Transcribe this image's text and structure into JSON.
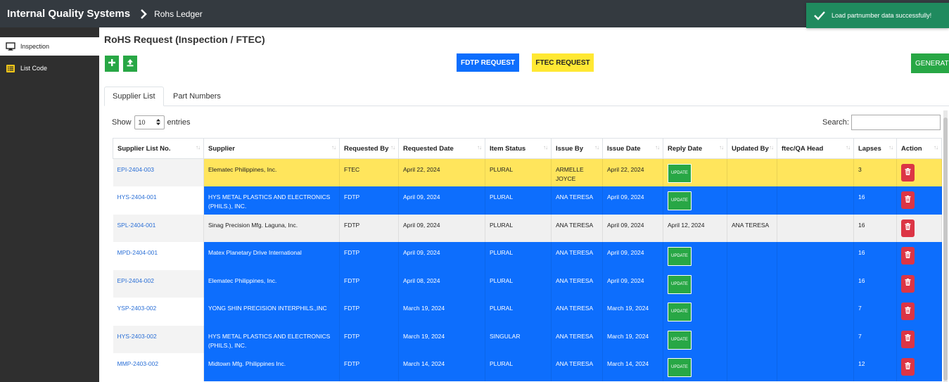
{
  "header": {
    "brand": "Internal Quality Systems",
    "breadcrumb": "Rohs Ledger"
  },
  "toast": {
    "message": "Load partnumber data successfully!"
  },
  "sidebar": {
    "items": [
      {
        "label": "Inspection",
        "icon": "monitor-icon",
        "active": true
      },
      {
        "label": "List Code",
        "icon": "list-icon",
        "active": false
      }
    ]
  },
  "main": {
    "title": "RoHS Request (Inspection / FTEC)",
    "buttons": {
      "add": "+",
      "fdtp": "FDTP REQUEST",
      "ftec": "FTEC REQUEST",
      "generate": "GENERAT"
    },
    "tabs": [
      {
        "label": "Supplier List",
        "active": true
      },
      {
        "label": "Part Numbers",
        "active": false
      }
    ],
    "show": {
      "prefix": "Show",
      "value": "10",
      "suffix": "entries"
    },
    "search": {
      "label": "Search:"
    }
  },
  "table": {
    "columns": [
      "Supplier List No.",
      "Supplier",
      "Requested By",
      "Requested Date",
      "Item Status",
      "Issue By",
      "Issue Date",
      "Reply Date",
      "Updated By",
      "ftec/QA Head",
      "Lapses",
      "Action"
    ],
    "update_label": "UPDATE",
    "rows": [
      {
        "no": "EPI-2404-003",
        "supplier": "Elematec Philippines, Inc.",
        "requested_by": "FTEC",
        "requested_date": "April 22, 2024",
        "status": "PLURAL",
        "issue_by": "ARMELLE JOYCE",
        "issue_date": "April 22, 2024",
        "reply_date": "",
        "updated_by": "",
        "qa_head": "",
        "lapses": "3",
        "color": "yellow"
      },
      {
        "no": "HYS-2404-001",
        "supplier": "HYS METAL PLASTICS AND ELECTRONICS (PHILS.), INC.",
        "requested_by": "FDTP",
        "requested_date": "April 09, 2024",
        "status": "PLURAL",
        "issue_by": "ANA TERESA",
        "issue_date": "April 09, 2024",
        "reply_date": "",
        "updated_by": "",
        "qa_head": "",
        "lapses": "16",
        "color": "blue"
      },
      {
        "no": "SPL-2404-001",
        "supplier": "Sinag Precision Mfg. Laguna, Inc.",
        "requested_by": "FDTP",
        "requested_date": "April 09, 2024",
        "status": "PLURAL",
        "issue_by": "ANA TERESA",
        "issue_date": "April 09, 2024",
        "reply_date": "April 12, 2024",
        "updated_by": "ANA TERESA",
        "qa_head": "",
        "lapses": "16",
        "color": "gray"
      },
      {
        "no": "MPD-2404-001",
        "supplier": "Matex Planetary Drive International",
        "requested_by": "FDTP",
        "requested_date": "April 09, 2024",
        "status": "PLURAL",
        "issue_by": "ANA TERESA",
        "issue_date": "April 09, 2024",
        "reply_date": "",
        "updated_by": "",
        "qa_head": "",
        "lapses": "16",
        "color": "blue"
      },
      {
        "no": "EPI-2404-002",
        "supplier": "Elematec Philippines, Inc.",
        "requested_by": "FDTP",
        "requested_date": "April 08, 2024",
        "status": "PLURAL",
        "issue_by": "ANA TERESA",
        "issue_date": "April 09, 2024",
        "reply_date": "",
        "updated_by": "",
        "qa_head": "",
        "lapses": "16",
        "color": "blue"
      },
      {
        "no": "YSP-2403-002",
        "supplier": "YONG SHIN PRECISION INTERPHILS.,INC",
        "requested_by": "FDTP",
        "requested_date": "March 19, 2024",
        "status": "PLURAL",
        "issue_by": "ANA TERESA",
        "issue_date": "March 19, 2024",
        "reply_date": "",
        "updated_by": "",
        "qa_head": "",
        "lapses": "7",
        "color": "blue"
      },
      {
        "no": "HYS-2403-002",
        "supplier": "HYS METAL PLASTICS AND ELECTRONICS (PHILS.), INC.",
        "requested_by": "FDTP",
        "requested_date": "March 19, 2024",
        "status": "SINGULAR",
        "issue_by": "ANA TERESA",
        "issue_date": "March 19, 2024",
        "reply_date": "",
        "updated_by": "",
        "qa_head": "",
        "lapses": "7",
        "color": "blue"
      },
      {
        "no": "MMP-2403-002",
        "supplier": "Midtown Mfg. Philippines Inc.",
        "requested_by": "FDTP",
        "requested_date": "March 14, 2024",
        "status": "PLURAL",
        "issue_by": "ANA TERESA",
        "issue_date": "March 14, 2024",
        "reply_date": "",
        "updated_by": "",
        "qa_head": "",
        "lapses": "12",
        "color": "blue"
      }
    ]
  }
}
